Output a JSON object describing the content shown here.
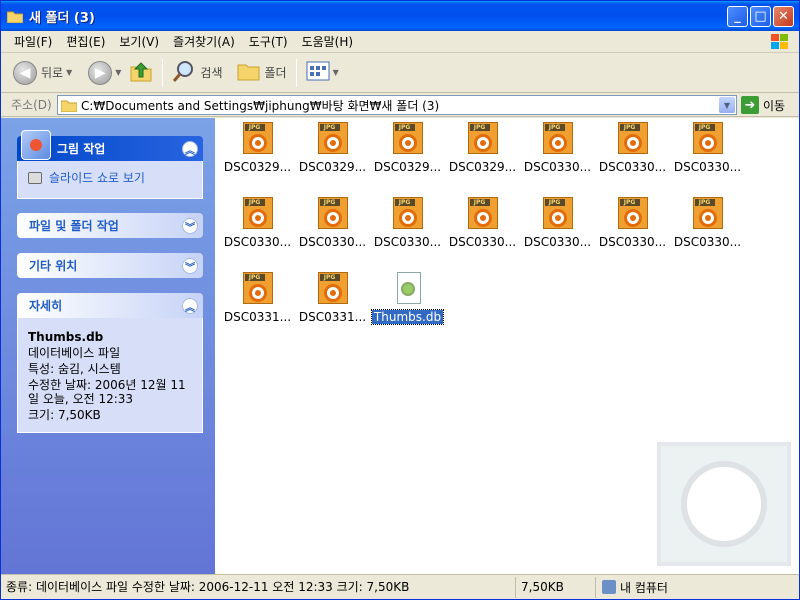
{
  "window": {
    "title": "새 폴더 (3)",
    "buttons": [
      "_",
      "□",
      "✕"
    ]
  },
  "menu": [
    "파일(F)",
    "편집(E)",
    "보기(V)",
    "즐겨찾기(A)",
    "도구(T)",
    "도움말(H)"
  ],
  "toolbar": {
    "back": "뒤로",
    "search": "검색",
    "folders": "폴더"
  },
  "address": {
    "label": "주소(D)",
    "path": "C:₩Documents and Settings₩jiphung₩바탕 화면₩새 폴더 (3)",
    "go": "이동"
  },
  "left_pane": {
    "picture_tasks": {
      "title": "그림 작업",
      "items": [
        "슬라이드 쇼로 보기"
      ]
    },
    "file_tasks": {
      "title": "파일 및 폴더 작업"
    },
    "other_places": {
      "title": "기타 위치"
    },
    "details": {
      "title": "자세히",
      "name": "Thumbs.db",
      "type": "데이터베이스 파일",
      "attributes": "특성: 숨김, 시스템",
      "modified": "수정한 날짜: 2006년 12월 11일 오늘, 오전 12:33",
      "size": "크기: 7,50KB"
    }
  },
  "files": [
    {
      "name": "DSC0329...",
      "type": "jpg"
    },
    {
      "name": "DSC0329...",
      "type": "jpg"
    },
    {
      "name": "DSC0329...",
      "type": "jpg"
    },
    {
      "name": "DSC0329...",
      "type": "jpg"
    },
    {
      "name": "DSC0330...",
      "type": "jpg"
    },
    {
      "name": "DSC0330...",
      "type": "jpg"
    },
    {
      "name": "DSC0330...",
      "type": "jpg"
    },
    {
      "name": "DSC0330...",
      "type": "jpg"
    },
    {
      "name": "DSC0330...",
      "type": "jpg"
    },
    {
      "name": "DSC0330...",
      "type": "jpg"
    },
    {
      "name": "DSC0330...",
      "type": "jpg"
    },
    {
      "name": "DSC0330...",
      "type": "jpg"
    },
    {
      "name": "DSC0330...",
      "type": "jpg"
    },
    {
      "name": "DSC0330...",
      "type": "jpg"
    },
    {
      "name": "DSC0331...",
      "type": "jpg"
    },
    {
      "name": "DSC0331...",
      "type": "jpg"
    },
    {
      "name": "Thumbs.db",
      "type": "db",
      "selected": true
    }
  ],
  "jpg_tag": "JPG",
  "status": {
    "info": "종류: 데이터베이스 파일 수정한 날짜: 2006-12-11 오전 12:33 크기: 7,50KB",
    "size": "7,50KB",
    "location": "내 컴퓨터"
  }
}
